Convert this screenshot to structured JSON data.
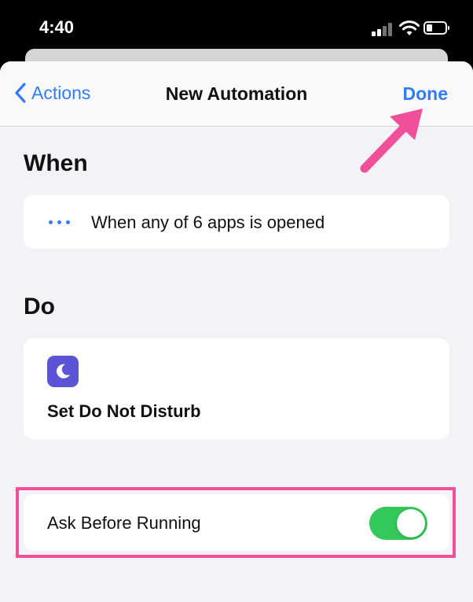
{
  "status_bar": {
    "time": "4:40"
  },
  "navbar": {
    "back_label": "Actions",
    "title": "New Automation",
    "done_label": "Done"
  },
  "when": {
    "heading": "When",
    "trigger_text": "When any of 6 apps is opened"
  },
  "do": {
    "heading": "Do",
    "action_text": "Set Do Not Disturb",
    "action_icon": "moon-icon"
  },
  "ask_before_running": {
    "label": "Ask Before Running",
    "enabled": true
  },
  "colors": {
    "accent": "#2f7cf6",
    "toggle_on": "#34c759",
    "highlight": "#f0509a",
    "icon_bg": "#5b54d6"
  }
}
